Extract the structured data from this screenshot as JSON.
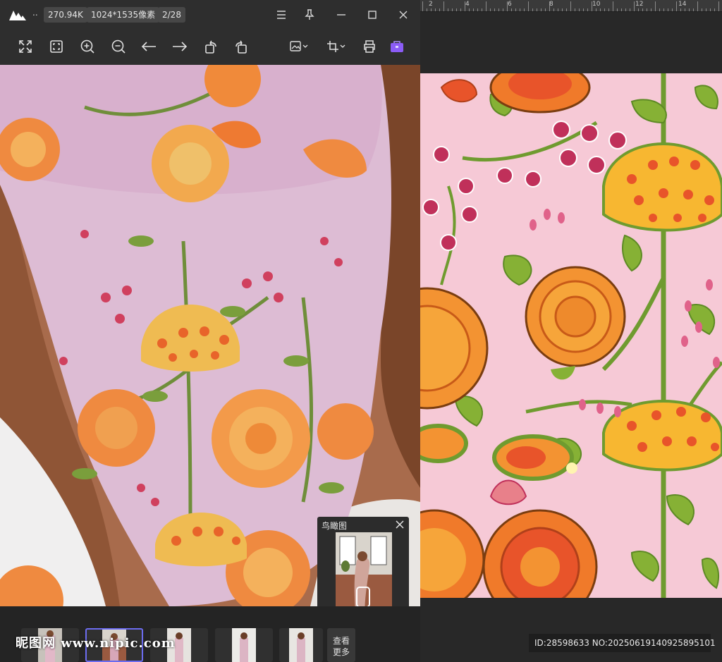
{
  "viewer": {
    "title_overflow": "..",
    "file_size": "270.94K",
    "dimensions": "1024*1535像素",
    "page_index": "2/28",
    "window_buttons": [
      "menu-icon",
      "pin-icon",
      "minimize-icon",
      "maximize-icon",
      "close-icon"
    ],
    "toolbar_tools": [
      "fit-screen-icon",
      "original-size-icon",
      "zoom-in-icon",
      "zoom-out-icon",
      "previous-arrow-icon",
      "next-arrow-icon",
      "rotate-left-icon",
      "rotate-right-icon",
      "image-options-icon",
      "crop-icon",
      "print-icon",
      "toolbox-icon"
    ],
    "accent_color": "#6c6cf0",
    "toolbox_color": "#8b5cf6"
  },
  "birdseye": {
    "title": "鸟瞰图"
  },
  "filmstrip": {
    "more_label_1": "查看",
    "more_label_2": "更多"
  },
  "watermark": {
    "site": "昵图网 www.nipic.com",
    "id_line": "ID:28598633 NO:20250619140925895101"
  },
  "editor": {
    "ruler_numbers": [
      "2",
      "4",
      "6",
      "8",
      "10",
      "12",
      "14"
    ],
    "pattern_background": "#f6c9d6"
  }
}
